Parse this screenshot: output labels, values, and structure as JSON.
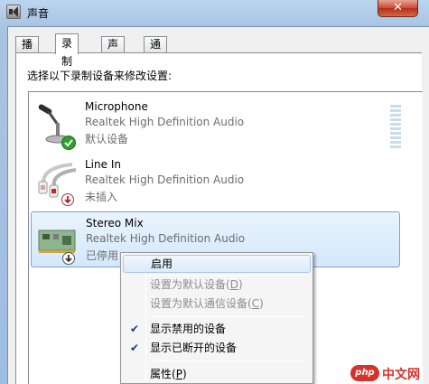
{
  "window": {
    "title": "声音",
    "close_label": "✕"
  },
  "tabs": [
    {
      "label": "播放",
      "active": false
    },
    {
      "label": "录制",
      "active": true
    },
    {
      "label": "声音",
      "active": false
    },
    {
      "label": "通信",
      "active": false
    }
  ],
  "panel": {
    "instruction": "选择以下录制设备来修改设置:"
  },
  "devices": [
    {
      "name": "Microphone",
      "driver": "Realtek High Definition Audio",
      "status": "默认设备",
      "icon": "microphone-icon",
      "badge": "default-check-icon"
    },
    {
      "name": "Line In",
      "driver": "Realtek High Definition Audio",
      "status": "未插入",
      "icon": "line-in-cable-icon",
      "badge": "unplugged-arrow-icon"
    },
    {
      "name": "Stereo Mix",
      "driver": "Realtek High Definition Audio",
      "status": "已停用",
      "icon": "sound-card-icon",
      "badge": "disabled-arrow-icon",
      "selected": true
    }
  ],
  "context_menu": {
    "items": [
      {
        "label": "启用",
        "enabled": true,
        "hovered": true
      },
      {
        "label": "设置为默认设备(D)",
        "text": "设置为默认设备(",
        "key": "D",
        "end": ")",
        "enabled": false
      },
      {
        "label": "设置为默认通信设备(C)",
        "text": "设置为默认通信设备(",
        "key": "C",
        "end": ")",
        "enabled": false
      },
      {
        "label": "显示禁用的设备",
        "enabled": true,
        "checked": true
      },
      {
        "label": "显示已断开的设备",
        "enabled": true,
        "checked": true
      },
      {
        "label": "属性(P)",
        "text": "属性(",
        "key": "P",
        "end": ")",
        "enabled": true
      }
    ]
  },
  "watermark": {
    "logo": "php",
    "text": "中文网"
  },
  "colors": {
    "selection_bg": "#dcebfc",
    "selection_border": "#7da2ce",
    "status_gray": "#6d6d6d",
    "check_green": "#2e9e2e",
    "close_red": "#c94a30"
  }
}
